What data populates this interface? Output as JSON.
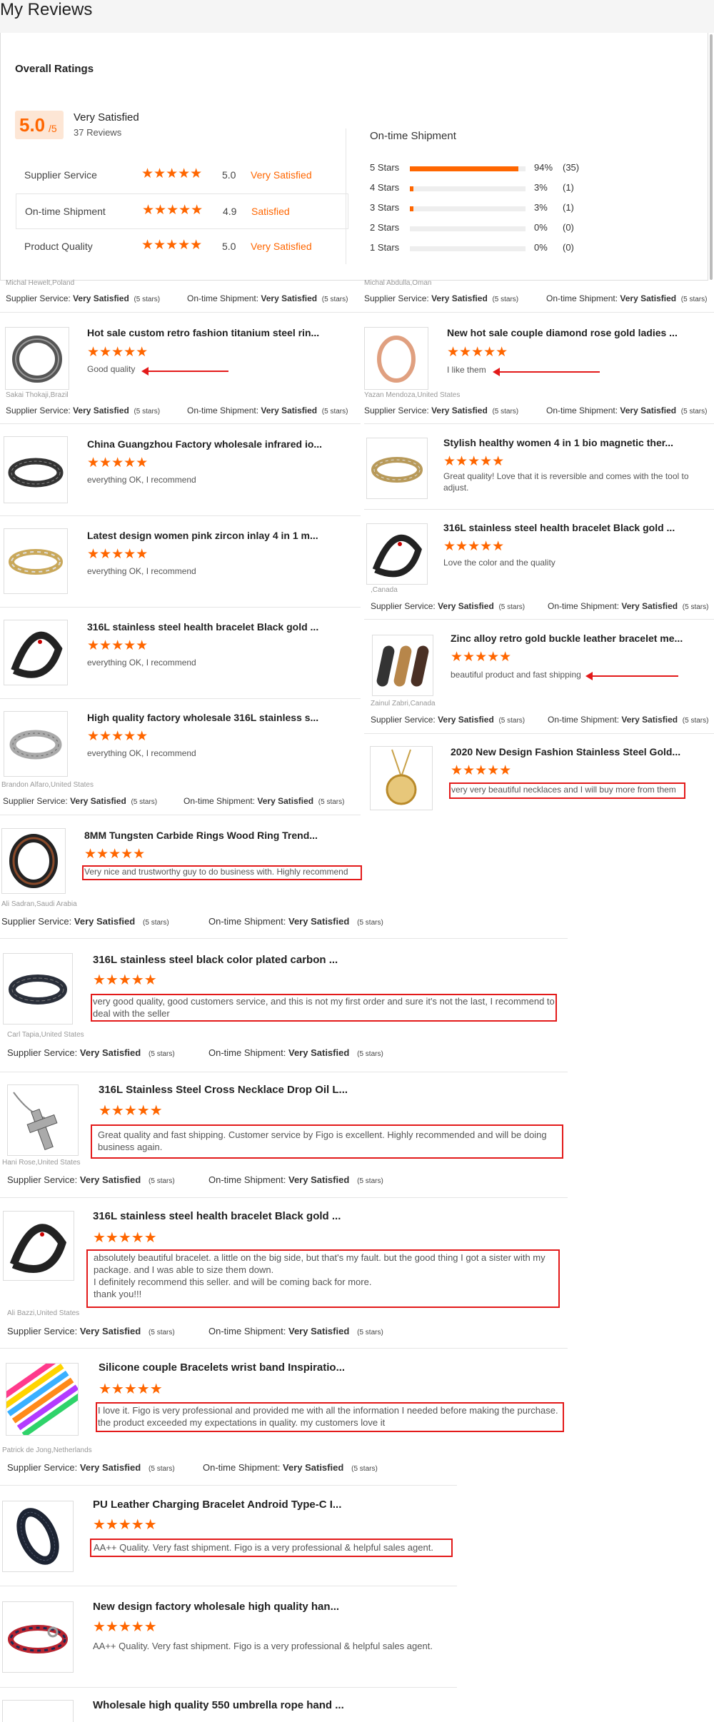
{
  "page_title": "My Reviews",
  "overall": {
    "title": "Overall Ratings",
    "score": "5.0",
    "score_max": "/5",
    "summary": "Very Satisfied",
    "reviews": "37 Reviews",
    "categories": [
      {
        "label": "Supplier Service",
        "stars": "★★★★★",
        "score": "5.0",
        "text": "Very Satisfied"
      },
      {
        "label": "On-time Shipment",
        "stars": "★★★★★",
        "score": "4.9",
        "text": "Satisfied"
      },
      {
        "label": "Product Quality",
        "stars": "★★★★★",
        "score": "5.0",
        "text": "Very Satisfied"
      }
    ]
  },
  "shipment": {
    "title": "On-time Shipment",
    "rows": [
      {
        "label": "5 Stars",
        "pct": "94%",
        "count": "(35)",
        "fill": 0.94
      },
      {
        "label": "4 Stars",
        "pct": "3%",
        "count": "(1)",
        "fill": 0.03
      },
      {
        "label": "3 Stars",
        "pct": "3%",
        "count": "(1)",
        "fill": 0.03
      },
      {
        "label": "2 Stars",
        "pct": "0%",
        "count": "(0)",
        "fill": 0
      },
      {
        "label": "1 Stars",
        "pct": "0%",
        "count": "(0)",
        "fill": 0
      }
    ]
  },
  "meta": {
    "supplier": "Supplier Service:",
    "shipment": "On-time Shipment:",
    "value": "Very Satisfied",
    "stars5": "(5 stars)"
  },
  "stars": "★★★★★",
  "reviewers": {
    "r1": "Michal Hewelt,Poland",
    "r2": "Michal Abdulla,Oman",
    "r3": "Sakai Thokaji,Brazil",
    "r4": "Yazan Mendoza,United States",
    "r5": ",Canada",
    "r6": "Zainul Zabri,Canada",
    "r7": "Brandon Alfaro,United States",
    "r8": "Ali Sadran,Saudi Arabia",
    "r9": "Carl Tapia,United States",
    "r10": "Hani Rose,United States",
    "r11": "Ali Bazzi,United States",
    "r12": "Patrick de Jong,Netherlands"
  },
  "reviews": {
    "l1": {
      "title": "Hot sale custom retro fashion titanium steel rin...",
      "text": "Good quality"
    },
    "l2": {
      "title": "China Guangzhou Factory wholesale infrared io...",
      "text": "everything OK, I recommend"
    },
    "l3": {
      "title": "Latest design women pink zircon inlay 4 in 1 m...",
      "text": "everything OK, I recommend"
    },
    "l4": {
      "title": "316L stainless steel health bracelet Black gold ...",
      "text": "everything OK, I recommend"
    },
    "l5": {
      "title": "High quality factory wholesale 316L stainless s...",
      "text": "everything OK, I recommend"
    },
    "r1": {
      "title": "New hot sale couple diamond rose gold ladies ...",
      "text": "I like them"
    },
    "r2": {
      "title": "Stylish healthy women 4 in 1 bio magnetic ther...",
      "text": "Great quality! Love that it is reversible and comes with the tool to adjust."
    },
    "r3": {
      "title": "316L stainless steel health bracelet Black gold ...",
      "text": "Love the color and the quality"
    },
    "r4": {
      "title": "Zinc alloy retro gold buckle leather bracelet me...",
      "text": "beautiful product and fast shipping"
    },
    "r5": {
      "title": "2020 New Design Fashion Stainless Steel Gold...",
      "text": "very very beautiful necklaces and I will buy more from them"
    },
    "f1": {
      "title": "8MM Tungsten Carbide Rings Wood Ring Trend...",
      "text": "Very nice and trustworthy guy to do business with. Highly recommend"
    },
    "f2": {
      "title": "316L stainless steel black color plated carbon ...",
      "text": "very good quality, good customers service, and this is not my first order and sure it's not the last, I recommend to deal with the seller"
    },
    "f3": {
      "title": "316L Stainless Steel Cross Necklace Drop Oil L...",
      "text": "Great quality and fast shipping. Customer service by Figo is excellent. Highly recommended and will be doing business again."
    },
    "f4": {
      "title": "316L stainless steel health bracelet Black gold ...",
      "text": "absolutely beautiful bracelet. a little on the big side, but that's my fault. but the good thing I got a sister with my package. and I was able to size them down.\nI definitely recommend this seller. and will be coming back for more.\nthank you!!!"
    },
    "f5": {
      "title": "Silicone couple Bracelets wrist band Inspiratio...",
      "text": "I love it. Figo is very professional and provided me with all the information I needed before making the purchase. the product exceeded my expectations in quality. my customers love it"
    },
    "f6": {
      "title": "PU Leather Charging Bracelet Android Type-C I...",
      "text": "AA++ Quality. Very fast shipment. Figo is a very professional & helpful sales agent."
    },
    "f7": {
      "title": "New design factory wholesale high quality han...",
      "text": "AA++ Quality. Very fast shipment. Figo is a very professional & helpful sales agent."
    },
    "f8": {
      "title": "Wholesale high quality 550 umbrella rope hand ..."
    }
  }
}
